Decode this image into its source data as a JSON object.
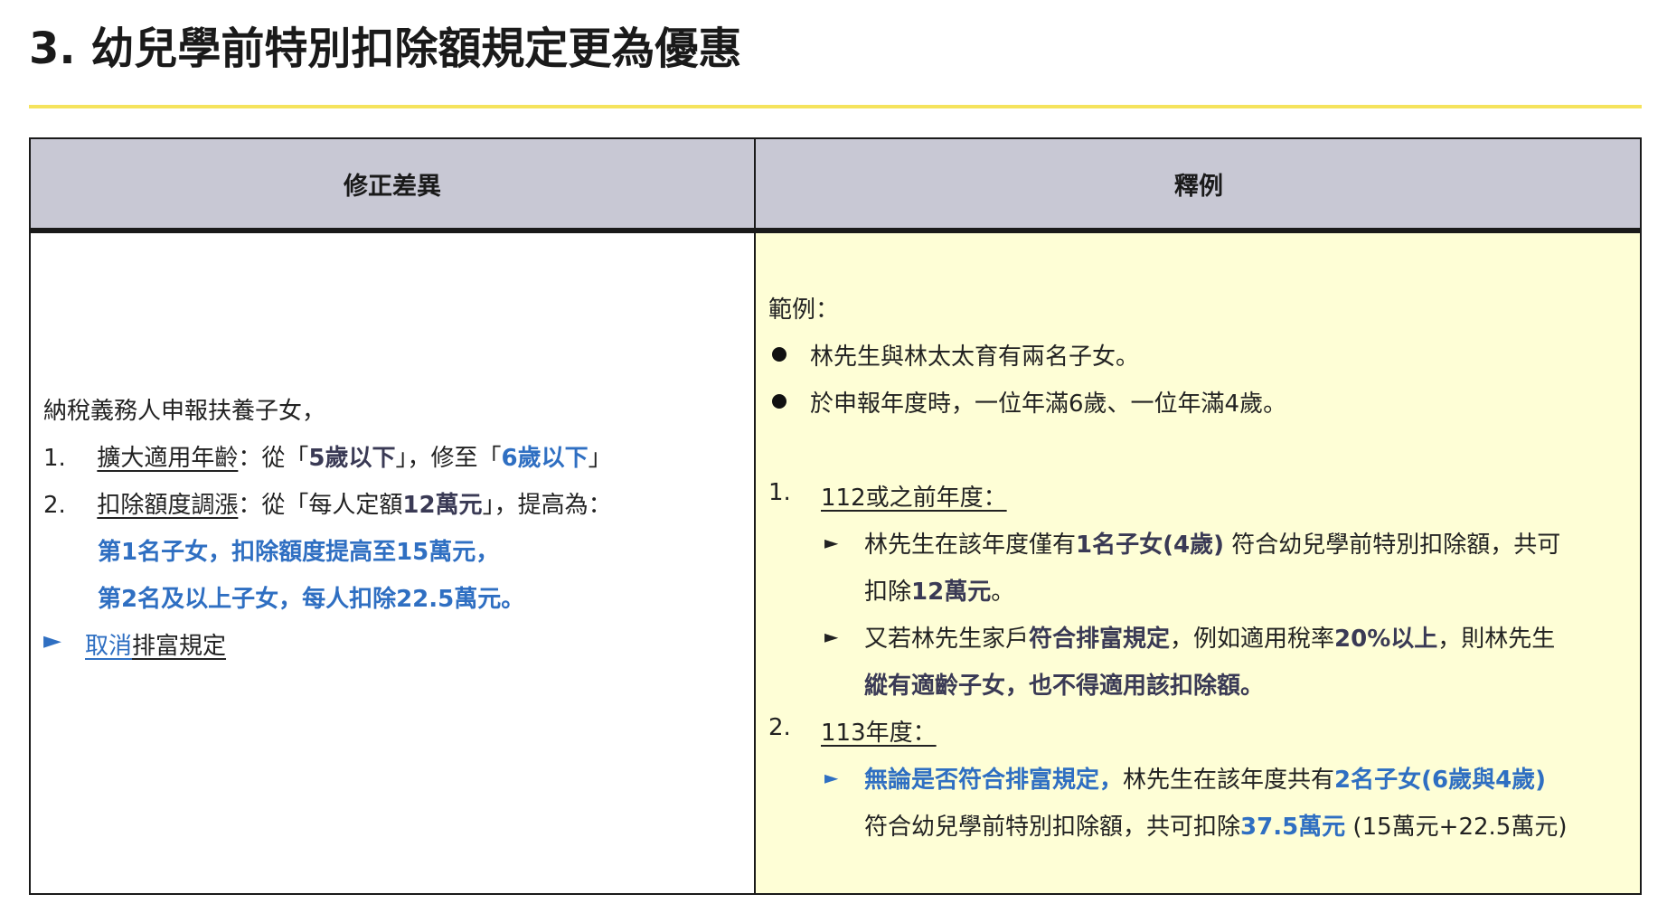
{
  "title": "3. 幼兒學前特別扣除額規定更為優惠",
  "table": {
    "headers": [
      "修正差異",
      "釋例"
    ],
    "left": {
      "intro": "納稅義務人申報扶養子女，",
      "item1": {
        "num": "1.",
        "term": "擴大適用年齡",
        "text_a": "：從「",
        "old": "5歲以下",
        "text_b": "」，修至「",
        "new": "6歲以下",
        "text_c": "」"
      },
      "item2": {
        "num": "2.",
        "term": "扣除額度調漲",
        "text_a": "：從「每人定額",
        "old": "12萬元",
        "text_b": "」，提高為：",
        "line2": "第1名子女，扣除額度提高至15萬元，",
        "line3": "第2名及以上子女，每人扣除22.5萬元。"
      },
      "item3": {
        "arrow": "►",
        "cancel": "取消",
        "rest": "排富規定"
      }
    },
    "right": {
      "example_label": "範例：",
      "bullet1": "林先生與林太太育有兩名子女。",
      "bullet2": "於申報年度時，一位年滿6歲、一位年滿4歲。",
      "sec1": {
        "num": "1.",
        "heading": "112或之前年度：",
        "p1_a": "林先生在該年度僅有",
        "p1_b": "1名子女(4歲)",
        "p1_c": " 符合幼兒學前特別扣除額，共可",
        "p1_d": "扣除",
        "p1_e": "12萬元",
        "p1_f": "。",
        "p2_a": "又若林先生家戶",
        "p2_b": "符合排富規定",
        "p2_c": "，例如適用稅率",
        "p2_d": "20%以上",
        "p2_e": "，則林先生",
        "p2_f": "縱有適齡子女，也不得適用該扣除額。"
      },
      "sec2": {
        "num": "2.",
        "heading": "113年度：",
        "p1_a": "無論是否符合排富規定，",
        "p1_b": "林先生在該年度共有",
        "p1_c": "2名子女(6歲與4歲)",
        "p2_a": "符合幼兒學前特別扣除額，共可扣除",
        "p2_b": "37.5萬元",
        "p2_c": " (15萬元+22.5萬元)"
      }
    }
  },
  "colors": {
    "accent_blue": "#2f6fc2",
    "header_bg": "#c8c8d4",
    "example_bg": "#fefed6",
    "title_rule": "#f5e35c"
  }
}
